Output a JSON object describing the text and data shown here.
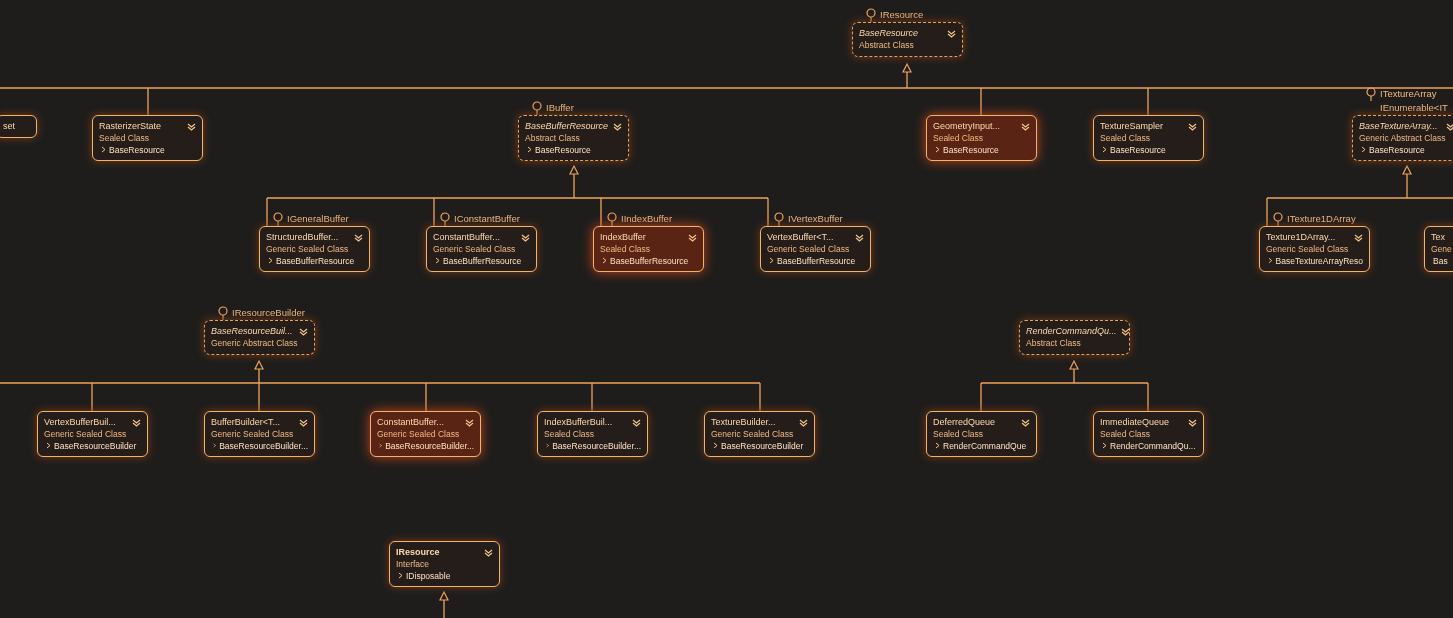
{
  "nodes": [
    {
      "title": "BaseResource",
      "kind": "abstract",
      "subtitle": "Abstract Class",
      "interfaces": [
        "IResource"
      ],
      "selected": false
    },
    {
      "title": "set",
      "kind": "class",
      "selected": false
    },
    {
      "title": "RasterizerState",
      "kind": "class",
      "subtitle": "Sealed Class",
      "base": "BaseResource",
      "selected": false
    },
    {
      "title": "BaseBufferResource",
      "kind": "abstract",
      "subtitle": "Abstract Class",
      "base": "BaseResource",
      "interfaces": [
        "IBuffer"
      ],
      "selected": false
    },
    {
      "title": "GeometryInput...",
      "kind": "class",
      "subtitle": "Sealed Class",
      "base": "BaseResource",
      "selected": true
    },
    {
      "title": "TextureSampler",
      "kind": "class",
      "subtitle": "Sealed Class",
      "base": "BaseResource",
      "selected": false
    },
    {
      "title": "BaseTextureArray...",
      "kind": "abstract",
      "subtitle": "Generic Abstract Class",
      "base": "BaseResource",
      "interfaces": [
        "ITextureArray",
        "IEnumerable<IT"
      ],
      "selected": false
    },
    {
      "title": "StructuredBuffer...",
      "kind": "class",
      "subtitle": "Generic Sealed Class",
      "base": "BaseBufferResource",
      "interfaces": [
        "IGeneralBuffer"
      ],
      "selected": false
    },
    {
      "title": "ConstantBuffer...",
      "kind": "class",
      "subtitle": "Generic Sealed Class",
      "base": "BaseBufferResource",
      "interfaces": [
        "IConstantBuffer"
      ],
      "selected": false
    },
    {
      "title": "IndexBuffer",
      "kind": "class",
      "subtitle": "Sealed Class",
      "base": "BaseBufferResource",
      "interfaces": [
        "IIndexBuffer"
      ],
      "selected": true
    },
    {
      "title": "VertexBuffer<T...",
      "kind": "class",
      "subtitle": "Generic Sealed Class",
      "base": "BaseBufferResource",
      "interfaces": [
        "IVertexBuffer"
      ],
      "selected": false
    },
    {
      "title": "Texture1DArray...",
      "kind": "class",
      "subtitle": "Generic Sealed Class",
      "base": "BaseTextureArrayReso",
      "interfaces": [
        "ITexture1DArray"
      ],
      "selected": false
    },
    {
      "title": "Tex",
      "kind": "class",
      "subtitle": "Gene",
      "base": "Bas",
      "selected": false
    },
    {
      "title": "BaseResourceBuil...",
      "kind": "abstract",
      "subtitle": "Generic Abstract Class",
      "interfaces": [
        "IResourceBuilder"
      ],
      "selected": false
    },
    {
      "title": "RenderCommandQu...",
      "kind": "abstract",
      "subtitle": "Abstract Class",
      "selected": false
    },
    {
      "title": "VertexBufferBuil...",
      "kind": "class",
      "subtitle": "Generic Sealed Class",
      "base": "BaseResourceBuilder",
      "selected": false
    },
    {
      "title": "BufferBuilder<T...",
      "kind": "class",
      "subtitle": "Generic Sealed Class",
      "base": "BaseResourceBuilder...",
      "selected": false
    },
    {
      "title": "ConstantBuffer...",
      "kind": "class",
      "subtitle": "Generic Sealed Class",
      "base": "BaseResourceBuilder...",
      "selected": true
    },
    {
      "title": "IndexBufferBuil...",
      "kind": "class",
      "subtitle": "Sealed Class",
      "base": "BaseResourceBuilder...",
      "selected": false
    },
    {
      "title": "TextureBuilder...",
      "kind": "class",
      "subtitle": "Generic Sealed Class",
      "base": "BaseResourceBuilder",
      "selected": false
    },
    {
      "title": "DeferredQueue",
      "kind": "class",
      "subtitle": "Sealed Class",
      "base": "RenderCommandQue",
      "selected": false
    },
    {
      "title": "ImmediateQueue",
      "kind": "class",
      "subtitle": "Sealed Class",
      "base": "RenderCommandQu...",
      "selected": false
    },
    {
      "title": "IResource",
      "kind": "interface",
      "subtitle": "Interface",
      "base": "IDisposable",
      "selected": false
    }
  ]
}
